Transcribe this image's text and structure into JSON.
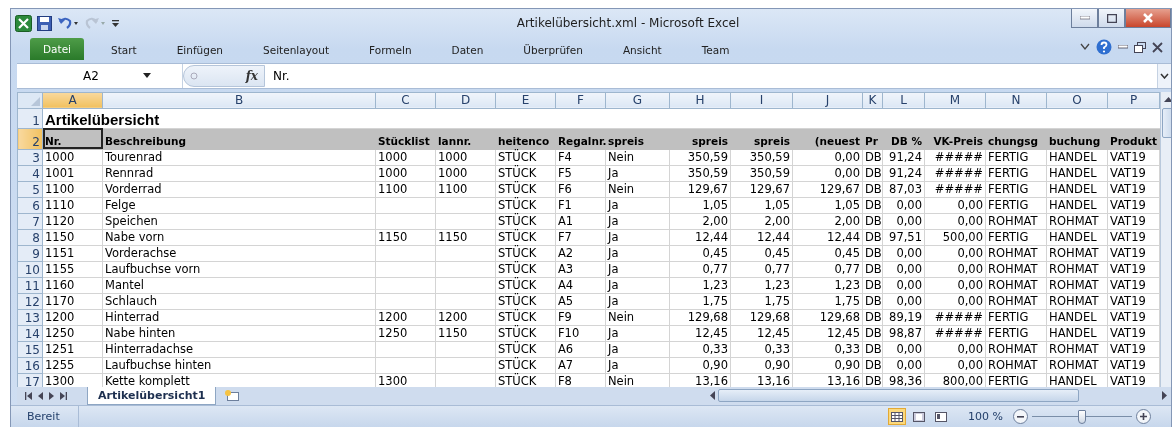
{
  "window": {
    "title": "Artikelübersicht.xml  -  Microsoft Excel"
  },
  "ribbon_tabs": [
    {
      "label": "Datei",
      "selected": true
    },
    {
      "label": "Start",
      "selected": false
    },
    {
      "label": "Einfügen",
      "selected": false
    },
    {
      "label": "Seitenlayout",
      "selected": false
    },
    {
      "label": "Formeln",
      "selected": false
    },
    {
      "label": "Daten",
      "selected": false
    },
    {
      "label": "Überprüfen",
      "selected": false
    },
    {
      "label": "Ansicht",
      "selected": false
    },
    {
      "label": "Team",
      "selected": false
    }
  ],
  "formula_bar": {
    "name_box": "A2",
    "function_label": "fx",
    "value": "Nr."
  },
  "columns": [
    {
      "letter": "A",
      "selected": true
    },
    {
      "letter": "B",
      "selected": false
    },
    {
      "letter": "C",
      "selected": false
    },
    {
      "letter": "D",
      "selected": false
    },
    {
      "letter": "E",
      "selected": false
    },
    {
      "letter": "F",
      "selected": false
    },
    {
      "letter": "G",
      "selected": false
    },
    {
      "letter": "H",
      "selected": false
    },
    {
      "letter": "I",
      "selected": false
    },
    {
      "letter": "J",
      "selected": false
    },
    {
      "letter": "K",
      "selected": false
    },
    {
      "letter": "L",
      "selected": false
    },
    {
      "letter": "M",
      "selected": false
    },
    {
      "letter": "N",
      "selected": false
    },
    {
      "letter": "O",
      "selected": false
    },
    {
      "letter": "P",
      "selected": false
    }
  ],
  "rows": [
    {
      "kind": "title",
      "number": "1",
      "selected": false,
      "cells": [
        "Artikelübersicht"
      ]
    },
    {
      "kind": "header",
      "number": "2",
      "selected": true,
      "cells": [
        "Nr.",
        "Beschreibung",
        "Stücklist",
        "lannr.",
        "heitenco",
        "Regalnr.",
        "spreis",
        "spreis",
        "spreis",
        "(neuest",
        "Pr",
        "DB %",
        "VK-Preis",
        "chungsg",
        "buchung",
        "Produkt"
      ]
    },
    {
      "kind": "data",
      "number": "3",
      "selected": false,
      "cells": [
        "1000",
        "Tourenrad",
        "1000",
        "1000",
        "STÜCK",
        "F4",
        "Nein",
        "350,59",
        "350,59",
        "0,00",
        "DB",
        "91,24",
        "#####",
        "FERTIG",
        "HANDEL",
        "VAT19"
      ]
    },
    {
      "kind": "data",
      "number": "4",
      "selected": false,
      "cells": [
        "1001",
        "Rennrad",
        "1000",
        "1000",
        "STÜCK",
        "F5",
        "Ja",
        "350,59",
        "350,59",
        "0,00",
        "DB",
        "91,24",
        "#####",
        "FERTIG",
        "HANDEL",
        "VAT19"
      ]
    },
    {
      "kind": "data",
      "number": "5",
      "selected": false,
      "cells": [
        "1100",
        "Vorderrad",
        "1100",
        "1100",
        "STÜCK",
        "F6",
        "Nein",
        "129,67",
        "129,67",
        "129,67",
        "DB",
        "87,03",
        "#####",
        "FERTIG",
        "HANDEL",
        "VAT19"
      ]
    },
    {
      "kind": "data",
      "number": "6",
      "selected": false,
      "cells": [
        "1110",
        "Felge",
        null,
        null,
        "STÜCK",
        "F1",
        "Ja",
        "1,05",
        "1,05",
        "1,05",
        "DB",
        "0,00",
        "0,00",
        "FERTIG",
        "HANDEL",
        "VAT19"
      ]
    },
    {
      "kind": "data",
      "number": "7",
      "selected": false,
      "cells": [
        "1120",
        "Speichen",
        null,
        null,
        "STÜCK",
        "A1",
        "Ja",
        "2,00",
        "2,00",
        "2,00",
        "DB",
        "0,00",
        "0,00",
        "ROHMAT",
        "ROHMAT",
        "VAT19"
      ]
    },
    {
      "kind": "data",
      "number": "8",
      "selected": false,
      "cells": [
        "1150",
        "Nabe vorn",
        "1150",
        "1150",
        "STÜCK",
        "F7",
        "Ja",
        "12,44",
        "12,44",
        "12,44",
        "DB",
        "97,51",
        "500,00",
        "FERTIG",
        "HANDEL",
        "VAT19"
      ]
    },
    {
      "kind": "data",
      "number": "9",
      "selected": false,
      "cells": [
        "1151",
        "Vorderachse",
        null,
        null,
        "STÜCK",
        "A2",
        "Ja",
        "0,45",
        "0,45",
        "0,45",
        "DB",
        "0,00",
        "0,00",
        "ROHMAT",
        "ROHMAT",
        "VAT19"
      ]
    },
    {
      "kind": "data",
      "number": "10",
      "selected": false,
      "cells": [
        "1155",
        "Laufbuchse vorn",
        null,
        null,
        "STÜCK",
        "A3",
        "Ja",
        "0,77",
        "0,77",
        "0,77",
        "DB",
        "0,00",
        "0,00",
        "ROHMAT",
        "ROHMAT",
        "VAT19"
      ]
    },
    {
      "kind": "data",
      "number": "11",
      "selected": false,
      "cells": [
        "1160",
        "Mantel",
        null,
        null,
        "STÜCK",
        "A4",
        "Ja",
        "1,23",
        "1,23",
        "1,23",
        "DB",
        "0,00",
        "0,00",
        "ROHMAT",
        "ROHMAT",
        "VAT19"
      ]
    },
    {
      "kind": "data",
      "number": "12",
      "selected": false,
      "cells": [
        "1170",
        "Schlauch",
        null,
        null,
        "STÜCK",
        "A5",
        "Ja",
        "1,75",
        "1,75",
        "1,75",
        "DB",
        "0,00",
        "0,00",
        "ROHMAT",
        "ROHMAT",
        "VAT19"
      ]
    },
    {
      "kind": "data",
      "number": "13",
      "selected": false,
      "cells": [
        "1200",
        "Hinterrad",
        "1200",
        "1200",
        "STÜCK",
        "F9",
        "Nein",
        "129,68",
        "129,68",
        "129,68",
        "DB",
        "89,19",
        "#####",
        "FERTIG",
        "HANDEL",
        "VAT19"
      ]
    },
    {
      "kind": "data",
      "number": "14",
      "selected": false,
      "cells": [
        "1250",
        "Nabe hinten",
        "1250",
        "1150",
        "STÜCK",
        "F10",
        "Ja",
        "12,45",
        "12,45",
        "12,45",
        "DB",
        "98,87",
        "#####",
        "FERTIG",
        "HANDEL",
        "VAT19"
      ]
    },
    {
      "kind": "data",
      "number": "15",
      "selected": false,
      "cells": [
        "1251",
        "Hinterradachse",
        null,
        null,
        "STÜCK",
        "A6",
        "Ja",
        "0,33",
        "0,33",
        "0,33",
        "DB",
        "0,00",
        "0,00",
        "ROHMAT",
        "ROHMAT",
        "VAT19"
      ]
    },
    {
      "kind": "data",
      "number": "16",
      "selected": false,
      "cells": [
        "1255",
        "Laufbuchse hinten",
        null,
        null,
        "STÜCK",
        "A7",
        "Ja",
        "0,90",
        "0,90",
        "0,90",
        "DB",
        "0,00",
        "0,00",
        "ROHMAT",
        "ROHMAT",
        "VAT19"
      ]
    },
    {
      "kind": "data",
      "number": "17",
      "selected": false,
      "cells": [
        "1300",
        "Kette komplett",
        "1300",
        null,
        "STÜCK",
        "F8",
        "Nein",
        "13,16",
        "13,16",
        "13,16",
        "DB",
        "98,36",
        "800,00",
        "FERTIG",
        "HANDEL",
        "VAT19"
      ]
    }
  ],
  "sheet_tabs": [
    {
      "label": "Artikelübersicht1",
      "selected": true
    }
  ],
  "status_bar": {
    "status": "Bereit",
    "zoom": "100 %",
    "zoom_slider": {
      "level": 0.5
    }
  }
}
